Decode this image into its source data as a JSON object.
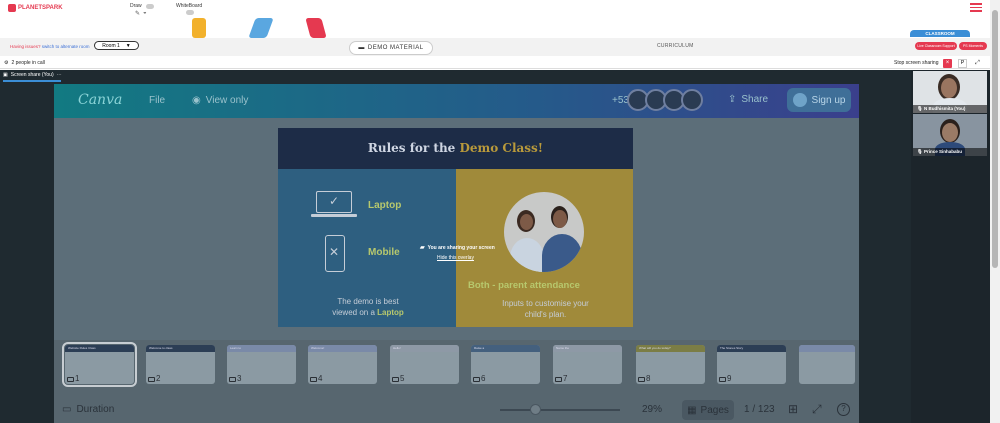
{
  "app": {
    "logo_text": "PLANETSPARK",
    "draw_label": "Draw",
    "whiteboard_label": "WhiteBoard"
  },
  "toolbar": {
    "issues_text": "Having issues?",
    "alternate_room_link": "switch to alternate room",
    "room_select_value": "Room 1",
    "demo_material_label": "DEMO MATERIAL",
    "curriculum_label": "CURRICULUM",
    "classroom_tab": "CLASSROOM",
    "support_pill": "Live Classroom Support",
    "ps_pill": "PS Moments"
  },
  "call": {
    "people_in_call": "2 people in call",
    "stop_sharing": "Stop screen sharing",
    "close_symbol": "×",
    "p_symbol": "P",
    "screen_share_tab": "Screen share (You)"
  },
  "canva": {
    "logo": "Canva",
    "file_menu": "File",
    "view_only": "View only",
    "collab_count": "+53",
    "share_label": "Share",
    "signup_label": "Sign up",
    "slide": {
      "title_part1": "Rules for the ",
      "title_part2": "Demo Class!",
      "laptop_label": "Laptop",
      "mobile_label": "Mobile",
      "demo_note_1": "The demo is best",
      "demo_note_2": "viewed on a ",
      "demo_note_bold": "Laptop",
      "parents_title": "Both - parent attendance",
      "parents_note_1": "Inputs to customise your",
      "parents_note_2": "child's plan."
    },
    "overlay_text": "You are sharing your screen",
    "hide_overlay": "Hide this overlay",
    "thumbnails": [
      {
        "num": "1",
        "title": "Website Rules Class"
      },
      {
        "num": "2",
        "title": "Welcome to class"
      },
      {
        "num": "3",
        "title": "Learn to"
      },
      {
        "num": "4",
        "title": "Welcome!"
      },
      {
        "num": "5",
        "title": "Hello!"
      },
      {
        "num": "6",
        "title": "Raise a"
      },
      {
        "num": "7",
        "title": "Name the"
      },
      {
        "num": "8",
        "title": "What will you do today?"
      },
      {
        "num": "9",
        "title": "The Stones Story"
      },
      {
        "num": "",
        "title": ""
      }
    ],
    "duration_label": "Duration",
    "zoom_level": "29%",
    "zoom_fraction": 0.29,
    "pages_label": "Pages",
    "page_counter": "1 / 123",
    "help_symbol": "?"
  },
  "participants": [
    {
      "name": "N Budhismita (You)"
    },
    {
      "name": "Prince Sinhababu"
    }
  ],
  "colors": {
    "brand_red": "#e53950",
    "accent_blue": "#3b8ed6",
    "dark_bg": "#1f2a30"
  }
}
